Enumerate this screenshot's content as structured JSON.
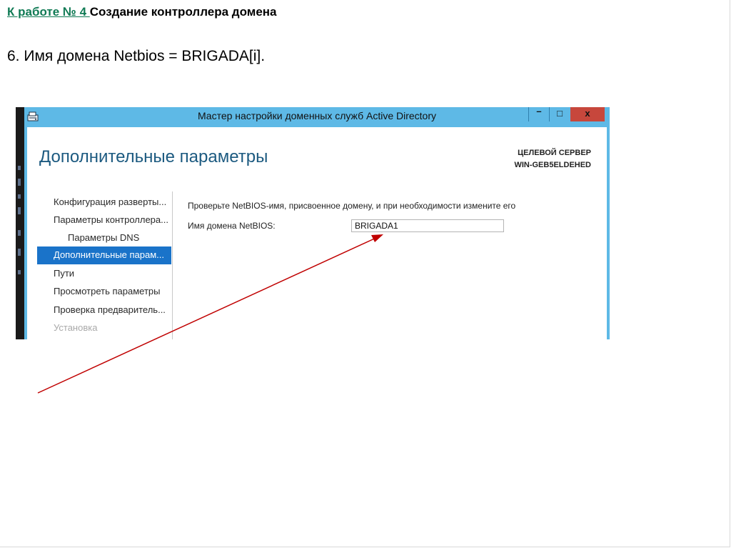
{
  "slide": {
    "title_link": "К работе № 4 ",
    "title_rest": "Создание контроллера домена",
    "step_text": "6. Имя домена Netbios = BRIGADA[i]."
  },
  "window": {
    "title": "Мастер настройки доменных служб Active Directory",
    "controls": {
      "minimize": "–",
      "maximize": "□",
      "close": "x"
    },
    "accent_color": "#5eb9e6"
  },
  "wizard": {
    "heading": "Дополнительные параметры",
    "target_label": "ЦЕЛЕВОЙ СЕРВЕР",
    "target_server": "WIN-GEB5ELDEHED",
    "nav": [
      {
        "label": "Конфигурация разверты..."
      },
      {
        "label": "Параметры контроллера..."
      },
      {
        "label": "Параметры DNS"
      },
      {
        "label": "Дополнительные парам..."
      },
      {
        "label": "Пути"
      },
      {
        "label": "Просмотреть параметры"
      },
      {
        "label": "Проверка предваритель..."
      },
      {
        "label": "Установка"
      }
    ],
    "instruction": "Проверьте NetBIOS-имя, присвоенное домену, и при необходимости измените его",
    "netbios_label": "Имя домена NetBIOS:",
    "netbios_value": "BRIGADA1"
  },
  "annotation": {
    "arrow_color": "#c00000"
  }
}
